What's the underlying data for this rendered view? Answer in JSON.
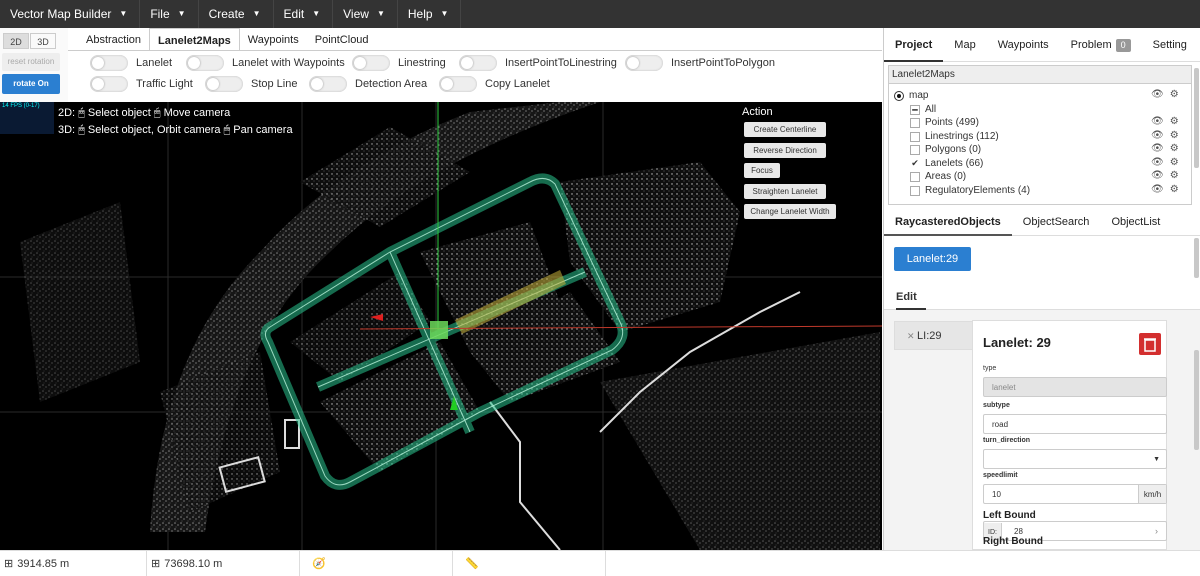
{
  "menubar": {
    "items": [
      {
        "label": "Vector Map Builder"
      },
      {
        "label": "File"
      },
      {
        "label": "Create"
      },
      {
        "label": "Edit"
      },
      {
        "label": "View"
      },
      {
        "label": "Help"
      }
    ]
  },
  "mode": {
    "btn_2d": "2D",
    "btn_3d": "3D",
    "reset_rotation": "reset rotation",
    "rotate_on": "rotate On"
  },
  "tabs": [
    "Abstraction",
    "Lanelet2Maps",
    "Waypoints",
    "PointCloud"
  ],
  "toggles": [
    "Lanelet",
    "Lanelet with Waypoints",
    "Linestring",
    "InsertPointToLinestring",
    "InsertPointToPolygon",
    "Traffic Light",
    "Stop Line",
    "Detection Area",
    "Copy Lanelet"
  ],
  "viewport": {
    "fps": "14 FPS (0-17)",
    "help_2d": {
      "prefix": "2D:",
      "a": "Select object",
      "b": "Move camera"
    },
    "help_3d": {
      "prefix": "3D:",
      "a": "Select object, Orbit camera",
      "b": "Pan camera"
    },
    "action_title": "Action",
    "actions": [
      "Create Centerline",
      "Reverse Direction",
      "Focus",
      "Straighten Lanelet",
      "Change Lanelet Width"
    ]
  },
  "status": {
    "x": "3914.85 m",
    "y": "73698.10 m"
  },
  "right": {
    "tabs": [
      "Project",
      "Map",
      "Waypoints",
      "Problem",
      "Setting"
    ],
    "problem_count": "0",
    "tree_header": "Lanelet2Maps",
    "tree_root": "map",
    "tree_items": [
      "All",
      "Points (499)",
      "Linestrings (112)",
      "Polygons (0)",
      "Lanelets (66)",
      "Areas (0)",
      "RegulatoryElements (4)"
    ],
    "rc_tabs": [
      "RaycasteredObjects",
      "ObjectSearch",
      "ObjectList"
    ],
    "selected_chip": "Lanelet:29",
    "edit_tab": "Edit",
    "ll_chip": "LI:29",
    "form": {
      "title": "Lanelet: 29",
      "type_label": "type",
      "type_value": "lanelet",
      "subtype_label": "subtype",
      "subtype_value": "road",
      "turn_label": "turn_direction",
      "turn_value": "",
      "speed_label": "speedlimit",
      "speed_value": "10",
      "speed_unit": "km/h",
      "left_bound": "Left Bound",
      "left_id_label": "ID:",
      "left_id": "28",
      "right_bound": "Right Bound"
    }
  },
  "colors": {
    "accent": "#2b7fd1",
    "menubar": "#333333",
    "lane": "#29c48e",
    "delete": "#d32f2f"
  }
}
